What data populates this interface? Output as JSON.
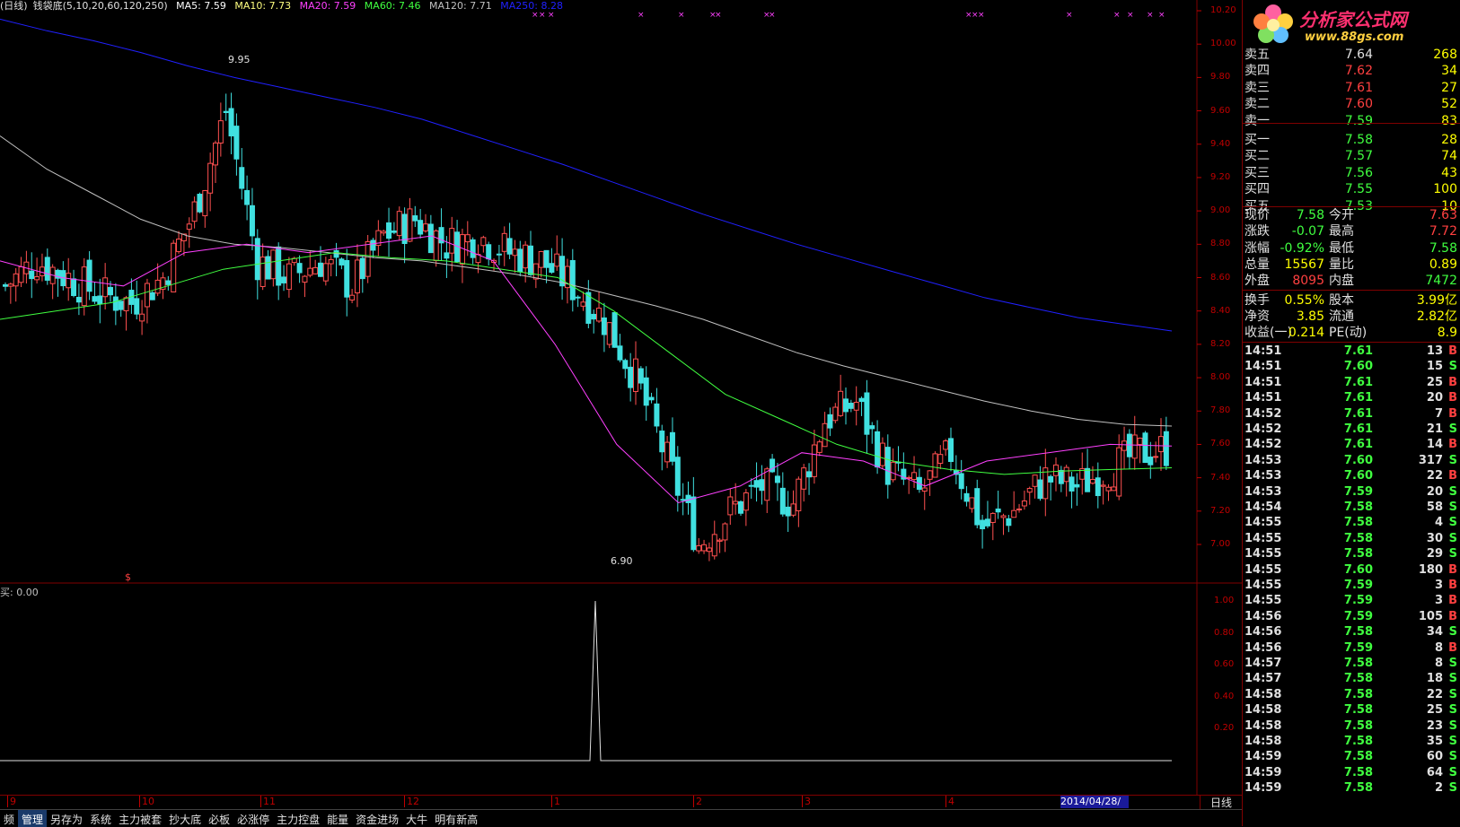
{
  "chart_header": {
    "period": "(日线)",
    "formula": "钱袋底(5,10,20,60,120,250)",
    "ma5": "MA5: 7.59",
    "ma10": "MA10: 7.73",
    "ma20": "MA20: 7.59",
    "ma60": "MA60: 7.46",
    "ma120": "MA120: 7.71",
    "ma250": "MA250: 8.28"
  },
  "colors": {
    "ma5": "#ffffff",
    "ma10": "#ffff80",
    "ma20": "#ff40ff",
    "ma60": "#40ff40",
    "ma120": "#c0c0c0",
    "ma250": "#2020ff",
    "up": "#ff5050",
    "down": "#40e0e0",
    "axis": "#c00000",
    "grid": "#800000"
  },
  "price_axis_labels": [
    "10.20",
    "10.00",
    "9.80",
    "9.60",
    "9.40",
    "9.20",
    "9.00",
    "8.80",
    "8.60",
    "8.40",
    "8.20",
    "8.00",
    "7.80",
    "7.60",
    "7.40",
    "7.20",
    "7.00"
  ],
  "annotations": {
    "high": "9.95",
    "low": "6.90",
    "signal_marker": "$"
  },
  "indicator": {
    "label": "买: 0.00",
    "axis_labels": [
      "1.00",
      "0.80",
      "0.60",
      "0.40",
      "0.20"
    ]
  },
  "time_axis": [
    "9",
    "10",
    "11",
    "12",
    "1",
    "2",
    "3",
    "4"
  ],
  "date_marker": "2014/04/28/一",
  "period_button": "日线",
  "bottom_tabs": [
    "频",
    "管理",
    "另存为",
    "系统",
    "主力被套",
    "抄大底",
    "必板",
    "必涨停",
    "主力控盘",
    "能量",
    "资金进场",
    "大牛",
    "明有新高"
  ],
  "logo": {
    "title": "分析家公式网",
    "url": "www.88gs.com"
  },
  "order_book": [
    {
      "label": "卖五",
      "price": "7.64",
      "vol": "268",
      "price_color": "#e0e0e0"
    },
    {
      "label": "卖四",
      "price": "7.62",
      "vol": "34",
      "price_color": "#ff4040"
    },
    {
      "label": "卖三",
      "price": "7.61",
      "vol": "27",
      "price_color": "#ff4040"
    },
    {
      "label": "卖二",
      "price": "7.60",
      "vol": "52",
      "price_color": "#ff4040"
    },
    {
      "label": "卖一",
      "price": "7.59",
      "vol": "83",
      "price_color": "#40ff40"
    },
    {
      "label": "买一",
      "price": "7.58",
      "vol": "28",
      "price_color": "#40ff40"
    },
    {
      "label": "买二",
      "price": "7.57",
      "vol": "74",
      "price_color": "#40ff40"
    },
    {
      "label": "买三",
      "price": "7.56",
      "vol": "43",
      "price_color": "#40ff40"
    },
    {
      "label": "买四",
      "price": "7.55",
      "vol": "100",
      "price_color": "#40ff40"
    },
    {
      "label": "买五",
      "price": "7.53",
      "vol": "10",
      "price_color": "#40ff40"
    }
  ],
  "quote": [
    {
      "l1": "现价",
      "v1": "7.58",
      "c1": "#40ff40",
      "l2": "今开",
      "v2": "7.63",
      "c2": "#ff4040"
    },
    {
      "l1": "涨跌",
      "v1": "-0.07",
      "c1": "#40ff40",
      "l2": "最高",
      "v2": "7.72",
      "c2": "#ff4040"
    },
    {
      "l1": "涨幅",
      "v1": "-0.92%",
      "c1": "#40ff40",
      "l2": "最低",
      "v2": "7.58",
      "c2": "#40ff40"
    },
    {
      "l1": "总量",
      "v1": "15567",
      "c1": "#ffff00",
      "l2": "量比",
      "v2": "0.89",
      "c2": "#ffff00"
    },
    {
      "l1": "外盘",
      "v1": "8095",
      "c1": "#ff4040",
      "l2": "内盘",
      "v2": "7472",
      "c2": "#40ff40"
    },
    {
      "l1": "换手",
      "v1": "0.55%",
      "c1": "#ffff00",
      "l2": "股本",
      "v2": "3.99亿",
      "c2": "#ffff00"
    },
    {
      "l1": "净资",
      "v1": "3.85",
      "c1": "#ffff00",
      "l2": "流通",
      "v2": "2.82亿",
      "c2": "#ffff00"
    },
    {
      "l1": "收益(一)",
      "v1": "0.214",
      "c1": "#ffff00",
      "l2": "PE(动)",
      "v2": "8.9",
      "c2": "#ffff00"
    }
  ],
  "ticks": [
    {
      "time": "14:51",
      "price": "7.61",
      "vol": "13",
      "side": "B"
    },
    {
      "time": "14:51",
      "price": "7.60",
      "vol": "15",
      "side": "S"
    },
    {
      "time": "14:51",
      "price": "7.61",
      "vol": "25",
      "side": "B"
    },
    {
      "time": "14:51",
      "price": "7.61",
      "vol": "20",
      "side": "B"
    },
    {
      "time": "14:52",
      "price": "7.61",
      "vol": "7",
      "side": "B"
    },
    {
      "time": "14:52",
      "price": "7.61",
      "vol": "21",
      "side": "S"
    },
    {
      "time": "14:52",
      "price": "7.61",
      "vol": "14",
      "side": "B"
    },
    {
      "time": "14:53",
      "price": "7.60",
      "vol": "317",
      "side": "S"
    },
    {
      "time": "14:53",
      "price": "7.60",
      "vol": "22",
      "side": "B"
    },
    {
      "time": "14:53",
      "price": "7.59",
      "vol": "20",
      "side": "S"
    },
    {
      "time": "14:54",
      "price": "7.58",
      "vol": "58",
      "side": "S"
    },
    {
      "time": "14:55",
      "price": "7.58",
      "vol": "4",
      "side": "S"
    },
    {
      "time": "14:55",
      "price": "7.58",
      "vol": "30",
      "side": "S"
    },
    {
      "time": "14:55",
      "price": "7.58",
      "vol": "29",
      "side": "S"
    },
    {
      "time": "14:55",
      "price": "7.60",
      "vol": "180",
      "side": "B"
    },
    {
      "time": "14:55",
      "price": "7.59",
      "vol": "3",
      "side": "B"
    },
    {
      "time": "14:55",
      "price": "7.59",
      "vol": "3",
      "side": "B"
    },
    {
      "time": "14:56",
      "price": "7.59",
      "vol": "105",
      "side": "B"
    },
    {
      "time": "14:56",
      "price": "7.58",
      "vol": "34",
      "side": "S"
    },
    {
      "time": "14:56",
      "price": "7.59",
      "vol": "8",
      "side": "B"
    },
    {
      "time": "14:57",
      "price": "7.58",
      "vol": "8",
      "side": "S"
    },
    {
      "time": "14:57",
      "price": "7.58",
      "vol": "18",
      "side": "S"
    },
    {
      "time": "14:58",
      "price": "7.58",
      "vol": "22",
      "side": "S"
    },
    {
      "time": "14:58",
      "price": "7.58",
      "vol": "25",
      "side": "S"
    },
    {
      "time": "14:58",
      "price": "7.58",
      "vol": "23",
      "side": "S"
    },
    {
      "time": "14:58",
      "price": "7.58",
      "vol": "35",
      "side": "S"
    },
    {
      "time": "14:59",
      "price": "7.58",
      "vol": "60",
      "side": "S"
    },
    {
      "time": "14:59",
      "price": "7.58",
      "vol": "64",
      "side": "S"
    },
    {
      "time": "14:59",
      "price": "7.58",
      "vol": "2",
      "side": "S"
    }
  ],
  "chart_data": {
    "type": "line",
    "title": "钱袋底(5,10,20,60,120,250)",
    "ylim": [
      6.9,
      10.2
    ],
    "x": [
      0,
      6,
      12,
      18,
      24,
      30,
      36,
      42,
      48,
      54,
      60,
      66,
      72,
      78,
      84,
      90,
      96,
      102,
      108,
      114,
      120,
      126,
      132,
      138,
      144,
      150,
      156,
      162,
      168,
      174,
      180,
      186,
      192,
      198,
      204,
      210,
      216,
      222
    ],
    "close": [
      8.55,
      8.7,
      8.6,
      8.5,
      8.45,
      8.6,
      9.0,
      9.6,
      8.7,
      8.6,
      8.7,
      8.55,
      8.85,
      8.95,
      8.8,
      8.85,
      8.75,
      8.7,
      8.55,
      8.35,
      8.0,
      7.5,
      7.0,
      7.2,
      7.35,
      7.25,
      7.75,
      7.85,
      7.45,
      7.3,
      7.55,
      7.1,
      7.2,
      7.4,
      7.35,
      7.45,
      7.55,
      7.58
    ],
    "series": [
      {
        "name": "MA250",
        "values": [
          10.15,
          10.08,
          10.02,
          9.95,
          9.87,
          9.8,
          9.74,
          9.68,
          9.62,
          9.55,
          9.46,
          9.37,
          9.28,
          9.18,
          9.08,
          8.98,
          8.89,
          8.8,
          8.72,
          8.64,
          8.56,
          8.48,
          8.42,
          8.36,
          8.32,
          8.28
        ]
      },
      {
        "name": "MA120",
        "values": [
          9.45,
          9.25,
          9.1,
          8.95,
          8.85,
          8.8,
          8.78,
          8.75,
          8.72,
          8.7,
          8.66,
          8.62,
          8.57,
          8.5,
          8.43,
          8.35,
          8.25,
          8.15,
          8.07,
          8.0,
          7.93,
          7.86,
          7.8,
          7.75,
          7.72,
          7.71
        ]
      },
      {
        "name": "MA60",
        "values": [
          8.35,
          8.4,
          8.45,
          8.55,
          8.65,
          8.7,
          8.75,
          8.72,
          8.7,
          8.65,
          8.6,
          8.4,
          8.15,
          7.9,
          7.75,
          7.6,
          7.5,
          7.45,
          7.42,
          7.44,
          7.45,
          7.46
        ]
      },
      {
        "name": "MA20",
        "values": [
          8.7,
          8.6,
          8.55,
          8.75,
          8.8,
          8.75,
          8.8,
          8.85,
          8.7,
          8.2,
          7.6,
          7.25,
          7.35,
          7.55,
          7.5,
          7.35,
          7.5,
          7.55,
          7.6,
          7.59
        ]
      }
    ],
    "indicator": {
      "name": "买",
      "spike_x": 132,
      "spike_value": 1.0,
      "ylim": [
        0,
        1.0
      ]
    }
  }
}
